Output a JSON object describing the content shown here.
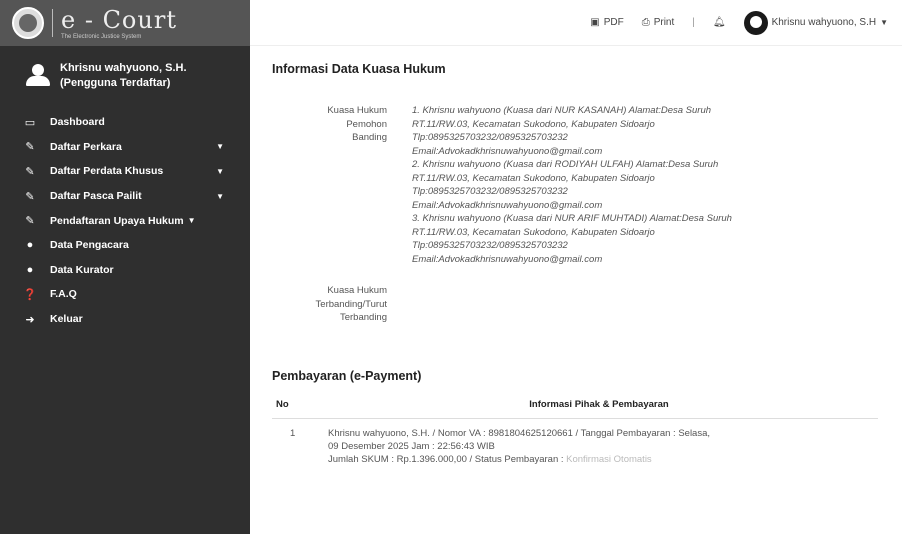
{
  "brand": {
    "title": "e - Court",
    "subtitle": "The Electronic Justice System"
  },
  "sidebar": {
    "user_name": "Khrisnu wahyuono, S.H.",
    "user_role": "(Pengguna Terdaftar)",
    "items": [
      {
        "label": "Dashboard",
        "icon": "monitor-icon",
        "caret": false
      },
      {
        "label": "Daftar Perkara",
        "icon": "edit-icon",
        "caret": true
      },
      {
        "label": "Daftar Perdata Khusus",
        "icon": "edit-icon",
        "caret": true
      },
      {
        "label": "Daftar Pasca Pailit",
        "icon": "edit-icon",
        "caret": true
      },
      {
        "label": "Pendaftaran Upaya Hukum",
        "icon": "edit-icon",
        "caret": true
      },
      {
        "label": "Data Pengacara",
        "icon": "user-icon",
        "caret": false
      },
      {
        "label": "Data Kurator",
        "icon": "user-icon",
        "caret": false
      },
      {
        "label": "F.A.Q",
        "icon": "question-icon",
        "caret": false
      },
      {
        "label": "Keluar",
        "icon": "logout-icon",
        "caret": false
      }
    ]
  },
  "topbar": {
    "pdf": "PDF",
    "print": "Print",
    "separator": "|",
    "user": "Khrisnu wahyuono, S.H"
  },
  "main": {
    "title": "Informasi Data Kuasa Hukum",
    "kuasa_pemohon_label": [
      "Kuasa Hukum",
      "Pemohon",
      "Banding"
    ],
    "kuasa_pemohon_lines": [
      "1. Khrisnu wahyuono (Kuasa dari NUR KASANAH) Alamat:Desa Suruh",
      "RT.11/RW.03, Kecamatan Sukodono, Kabupaten Sidoarjo",
      "Tlp:0895325703232/0895325703232",
      "Email:Advokadkhrisnuwahyuono@gmail.com",
      "2. Khrisnu wahyuono (Kuasa dari RODIYAH ULFAH) Alamat:Desa Suruh",
      "RT.11/RW.03, Kecamatan Sukodono, Kabupaten Sidoarjo",
      "Tlp:0895325703232/0895325703232",
      "Email:Advokadkhrisnuwahyuono@gmail.com",
      "3. Khrisnu wahyuono (Kuasa dari NUR ARIF MUHTADI) Alamat:Desa Suruh",
      "RT.11/RW.03, Kecamatan Sukodono, Kabupaten Sidoarjo",
      "Tlp:0895325703232/0895325703232",
      "Email:Advokadkhrisnuwahyuono@gmail.com"
    ],
    "kuasa_terbanding_label": [
      "Kuasa Hukum",
      "Terbanding/Turut",
      "Terbanding"
    ],
    "payment_title": "Pembayaran (e-Payment)",
    "payment_headers": {
      "no": "No",
      "info": "Informasi Pihak & Pembayaran"
    },
    "payment_rows": [
      {
        "no": "1",
        "line1": "Khrisnu wahyuono, S.H. / Nomor VA : 8981804625120661 / Tanggal Pembayaran : Selasa,",
        "line2": "09 Desember 2025 Jam : 22:56:43 WIB",
        "line3": "Jumlah SKUM : Rp.1.396.000,00 / Status Pembayaran : ",
        "status": "Konfirmasi Otomatis"
      }
    ]
  }
}
